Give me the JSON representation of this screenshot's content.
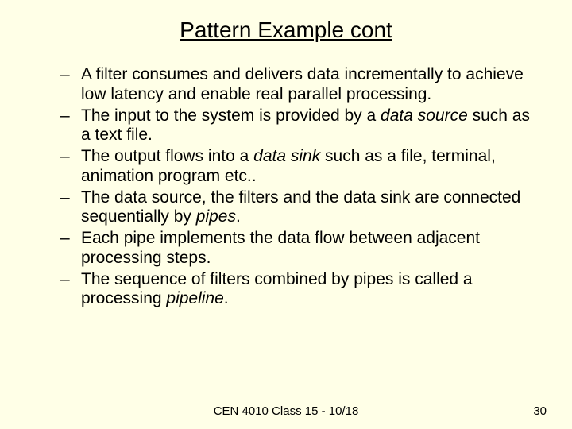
{
  "title": "Pattern Example cont",
  "bullets": [
    {
      "pre": "A filter consumes and delivers data incrementally to achieve low latency and enable real parallel processing.",
      "italic": "",
      "post": ""
    },
    {
      "pre": "The input to the system is provided by a ",
      "italic": "data source",
      "post": " such as a text file."
    },
    {
      "pre": "The output flows into a ",
      "italic": "data sink",
      "post": " such as a file, terminal, animation program etc.."
    },
    {
      "pre": "The data source, the filters and the data sink are connected sequentially by ",
      "italic": "pipes",
      "post": "."
    },
    {
      "pre": "Each pipe implements the data flow between adjacent processing steps.",
      "italic": "",
      "post": ""
    },
    {
      "pre": "The sequence of filters combined by pipes is called a processing ",
      "italic": "pipeline",
      "post": "."
    }
  ],
  "footer_center": "CEN 4010 Class 15 - 10/18",
  "footer_right": "30"
}
